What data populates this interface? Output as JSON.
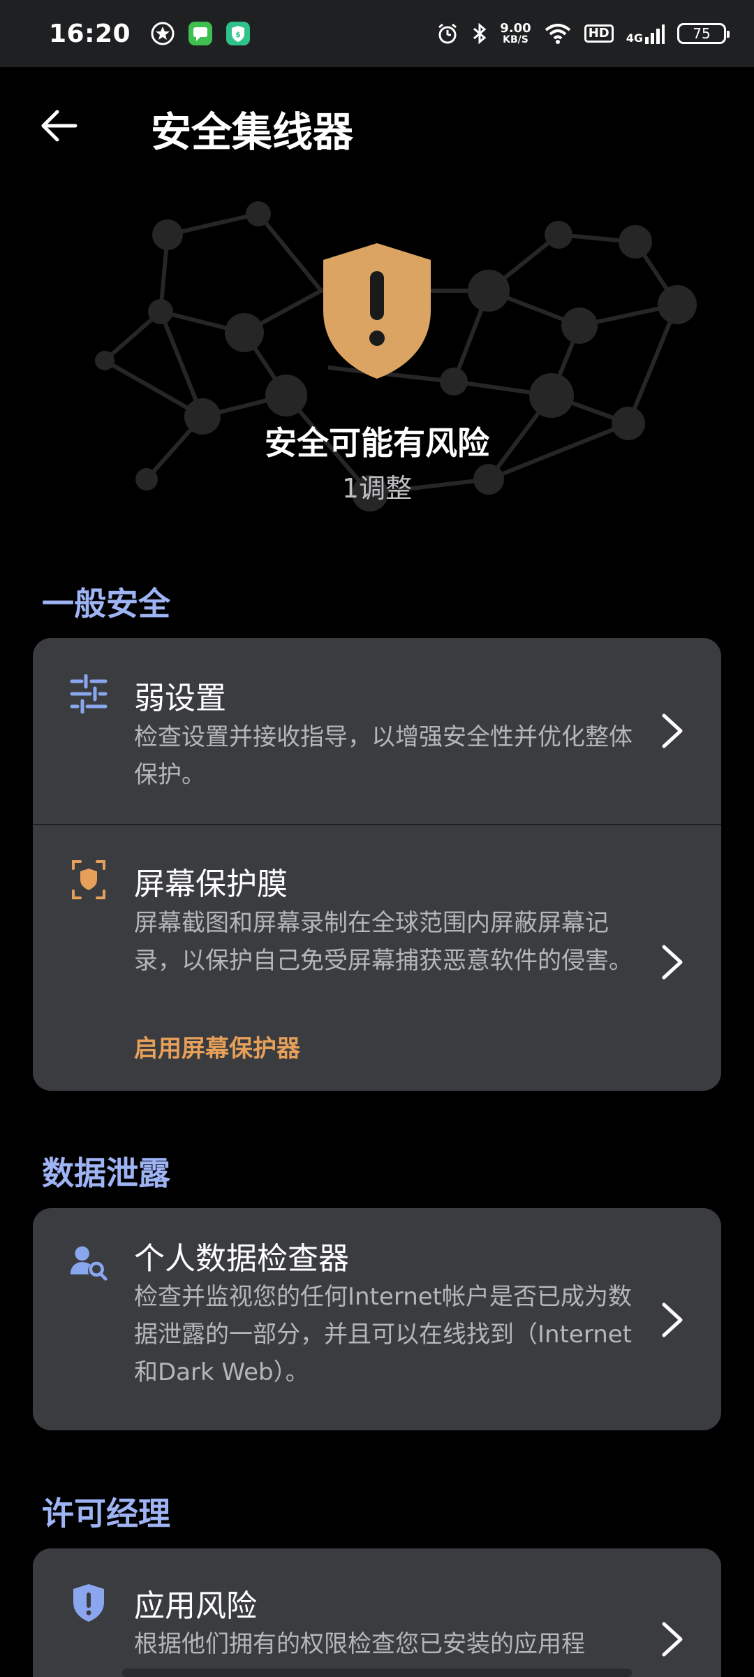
{
  "status_bar": {
    "time": "16:20",
    "net_speed_value": "9.00",
    "net_speed_unit": "KB/S",
    "hd_label": "HD",
    "network_type": "4G",
    "battery": "75"
  },
  "app_bar": {
    "title": "安全集线器"
  },
  "hero": {
    "status_title": "安全可能有风险",
    "status_sub": "1调整",
    "accent_color": "#dba462"
  },
  "sections": {
    "general": {
      "header": "一般安全",
      "items": [
        {
          "title": "弱设置",
          "desc": "检查设置并接收指导，以增强安全性并优化整体保护。"
        },
        {
          "title": "屏幕保护膜",
          "desc": "屏幕截图和屏幕录制在全球范围内屏蔽屏幕记录，以保护自己免受屏幕捕获恶意软件的侵害。",
          "action": "启用屏幕保护器"
        }
      ]
    },
    "data_leak": {
      "header": "数据泄露",
      "items": [
        {
          "title": "个人数据检查器",
          "desc": "检查并监视您的任何Internet帐户是否已成为数据泄露的一部分，并且可以在线找到（Internet和Dark Web）。"
        }
      ]
    },
    "permission": {
      "header": "许可经理",
      "items": [
        {
          "title": "应用风险",
          "desc": "根据他们拥有的权限检查您已安装的应用程"
        }
      ]
    }
  },
  "colors": {
    "section_header": "#9fb4f5",
    "card_bg": "#3a3c40",
    "action": "#e7a05a",
    "icon_blue": "#8aa6ee",
    "icon_orange": "#e7a05a"
  }
}
